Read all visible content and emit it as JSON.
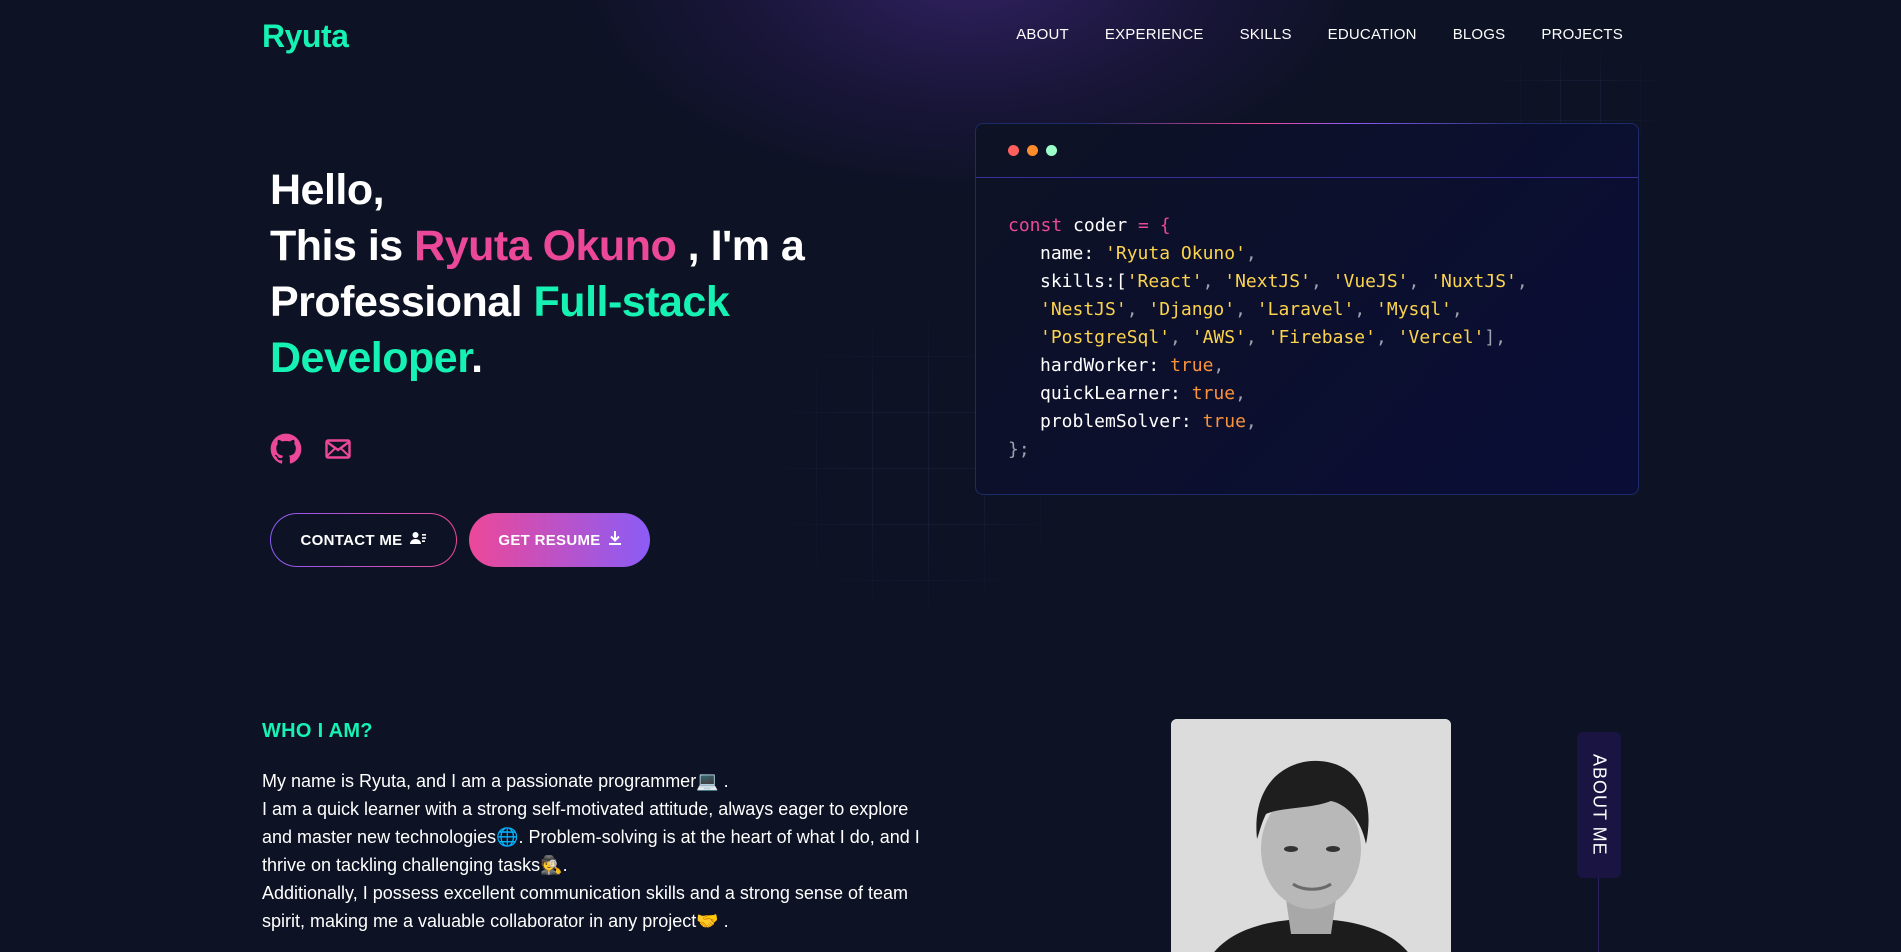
{
  "nav": {
    "brand": "Ryuta",
    "items": [
      {
        "label": "ABOUT"
      },
      {
        "label": "EXPERIENCE"
      },
      {
        "label": "SKILLS"
      },
      {
        "label": "EDUCATION"
      },
      {
        "label": "BLOGS"
      },
      {
        "label": "PROJECTS"
      }
    ]
  },
  "hero": {
    "line1": "Hello,",
    "this_is": "This is ",
    "name": "Ryuta Okuno",
    "im_a": " , I'm a",
    "professional": "Professional ",
    "role": "Full-stack Developer",
    "period": ".",
    "socials": [
      {
        "icon": "github-icon"
      },
      {
        "icon": "mail-icon"
      }
    ],
    "contact_button": "CONTACT ME",
    "resume_button": "GET RESUME"
  },
  "code": {
    "colors": {
      "red": "#ff605c",
      "yellow": "#ff8c2a",
      "green": "#9dffc9"
    },
    "const_kw": "const",
    "var_name": "coder",
    "eq_open": " = {",
    "name_key": "name:",
    "name_val": "'Ryuta Okuno'",
    "skills_key": "skills:[",
    "skills": [
      "'React'",
      "'NextJS'",
      "'VueJS'",
      "'NuxtJS'",
      "'NestJS'",
      "'Django'",
      "'Laravel'",
      "'Mysql'",
      "'PostgreSql'",
      "'AWS'",
      "'Firebase'",
      "'Vercel'"
    ],
    "hard_key": "hardWorker:",
    "quick_key": "quickLearner:",
    "problem_key": "problemSolver:",
    "true_val": "true",
    "close": "};"
  },
  "about": {
    "title": "WHO I AM?",
    "p1": "My name is Ryuta, and I am a passionate programmer💻 .",
    "p2": "I am a quick learner with a strong self-motivated attitude, always eager to explore and master new technologies🌐. Problem-solving is at the heart of what I do, and I thrive on tackling challenging tasks🕵️.",
    "p3": "Additionally, I possess excellent communication skills and a strong sense of team spirit, making me a valuable collaborator in any project🤝 .",
    "tab_label": "ABOUT ME"
  }
}
